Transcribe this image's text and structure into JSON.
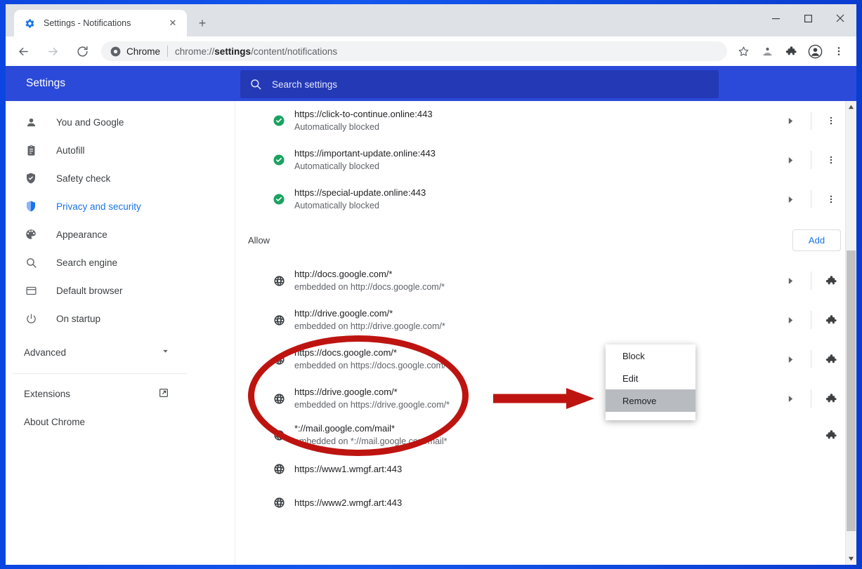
{
  "window": {
    "controls": [
      {
        "name": "minimize",
        "glyph": "–"
      },
      {
        "name": "maximize",
        "glyph": "□"
      },
      {
        "name": "close",
        "glyph": "✕"
      }
    ]
  },
  "tab": {
    "title": "Settings - Notifications",
    "favicon": "gear-icon",
    "close_glyph": "✕",
    "new_tab_glyph": "+"
  },
  "toolbar": {
    "back_glyph": "←",
    "forward_glyph": "→",
    "reload_glyph": "↻",
    "omnibox": {
      "icon": "chrome-logo-icon",
      "scheme_label": "Chrome",
      "url_prefix": "chrome://",
      "url_bold": "settings",
      "url_suffix": "/content/notifications"
    },
    "icons": [
      {
        "name": "bookmark-star-icon",
        "glyph": "☆"
      },
      {
        "name": "share-profile-icon",
        "glyph": "♟"
      },
      {
        "name": "extensions-puzzle-icon",
        "glyph": "❖"
      },
      {
        "name": "profile-avatar-icon",
        "glyph": "●"
      },
      {
        "name": "chrome-menu-icon",
        "glyph": "⋮"
      }
    ]
  },
  "settings_header": {
    "title": "Settings",
    "search_placeholder": "Search settings",
    "search_value": "",
    "search_icon": "search-icon",
    "bg_color": "#2b4ad9",
    "search_bg_color": "#2439b6"
  },
  "sidebar": {
    "items": [
      {
        "label": "You and Google",
        "icon": "person-icon",
        "active": false
      },
      {
        "label": "Autofill",
        "icon": "clipboard-icon",
        "active": false
      },
      {
        "label": "Safety check",
        "icon": "shield-check-icon",
        "active": false
      },
      {
        "label": "Privacy and security",
        "icon": "shield-icon",
        "active": true
      },
      {
        "label": "Appearance",
        "icon": "palette-icon",
        "active": false
      },
      {
        "label": "Search engine",
        "icon": "search-icon",
        "active": false
      },
      {
        "label": "Default browser",
        "icon": "browser-window-icon",
        "active": false
      },
      {
        "label": "On startup",
        "icon": "power-icon",
        "active": false
      }
    ],
    "advanced": {
      "label": "Advanced",
      "icon": "chevron-down-icon"
    },
    "bottom": [
      {
        "label": "Extensions",
        "icon": "external-link-icon"
      },
      {
        "label": "About Chrome",
        "icon": null
      }
    ],
    "active_color": "#1a73e8"
  },
  "main": {
    "blocked_rows": [
      {
        "title": "https://click-to-continue.online:443",
        "sub": "Automatically blocked",
        "icon": "green-check-icon"
      },
      {
        "title": "https://important-update.online:443",
        "sub": "Automatically blocked",
        "icon": "green-check-icon"
      },
      {
        "title": "https://special-update.online:443",
        "sub": "Automatically blocked",
        "icon": "green-check-icon"
      }
    ],
    "allow_section": {
      "label": "Allow",
      "add_label": "Add"
    },
    "allow_rows": [
      {
        "title": "http://docs.google.com/*",
        "sub": "embedded on http://docs.google.com/*",
        "icon": "globe-icon",
        "action": "puzzle-icon"
      },
      {
        "title": "http://drive.google.com/*",
        "sub": "embedded on http://drive.google.com/*",
        "icon": "globe-icon",
        "action": "puzzle-icon"
      },
      {
        "title": "https://docs.google.com/*",
        "sub": "embedded on https://docs.google.com/*",
        "icon": "globe-icon",
        "action": "puzzle-icon"
      },
      {
        "title": "https://drive.google.com/*",
        "sub": "embedded on https://drive.google.com/*",
        "icon": "globe-icon",
        "action": "puzzle-icon"
      },
      {
        "title": "*://mail.google.com/mail*",
        "sub": "embedded on *://mail.google.com/mail*",
        "icon": "globe-icon",
        "action": "puzzle-icon"
      },
      {
        "title": "https://www1.wmgf.art:443",
        "sub": "",
        "icon": "globe-icon",
        "action": ""
      },
      {
        "title": "https://www2.wmgf.art:443",
        "sub": "",
        "icon": "globe-icon",
        "action": ""
      }
    ]
  },
  "context_menu": {
    "items": [
      {
        "label": "Block",
        "highlighted": false
      },
      {
        "label": "Edit",
        "highlighted": false
      },
      {
        "label": "Remove",
        "highlighted": true
      }
    ],
    "highlight_color": "#b8bcc0"
  },
  "annotations": {
    "color": "#be1410",
    "ellipse": "highlight-ellipse",
    "arrow": "pointer-arrow"
  },
  "scrollbar": {
    "up_glyph": "▲",
    "down_glyph": "▼",
    "thumb_color": "#c1c1c1"
  }
}
